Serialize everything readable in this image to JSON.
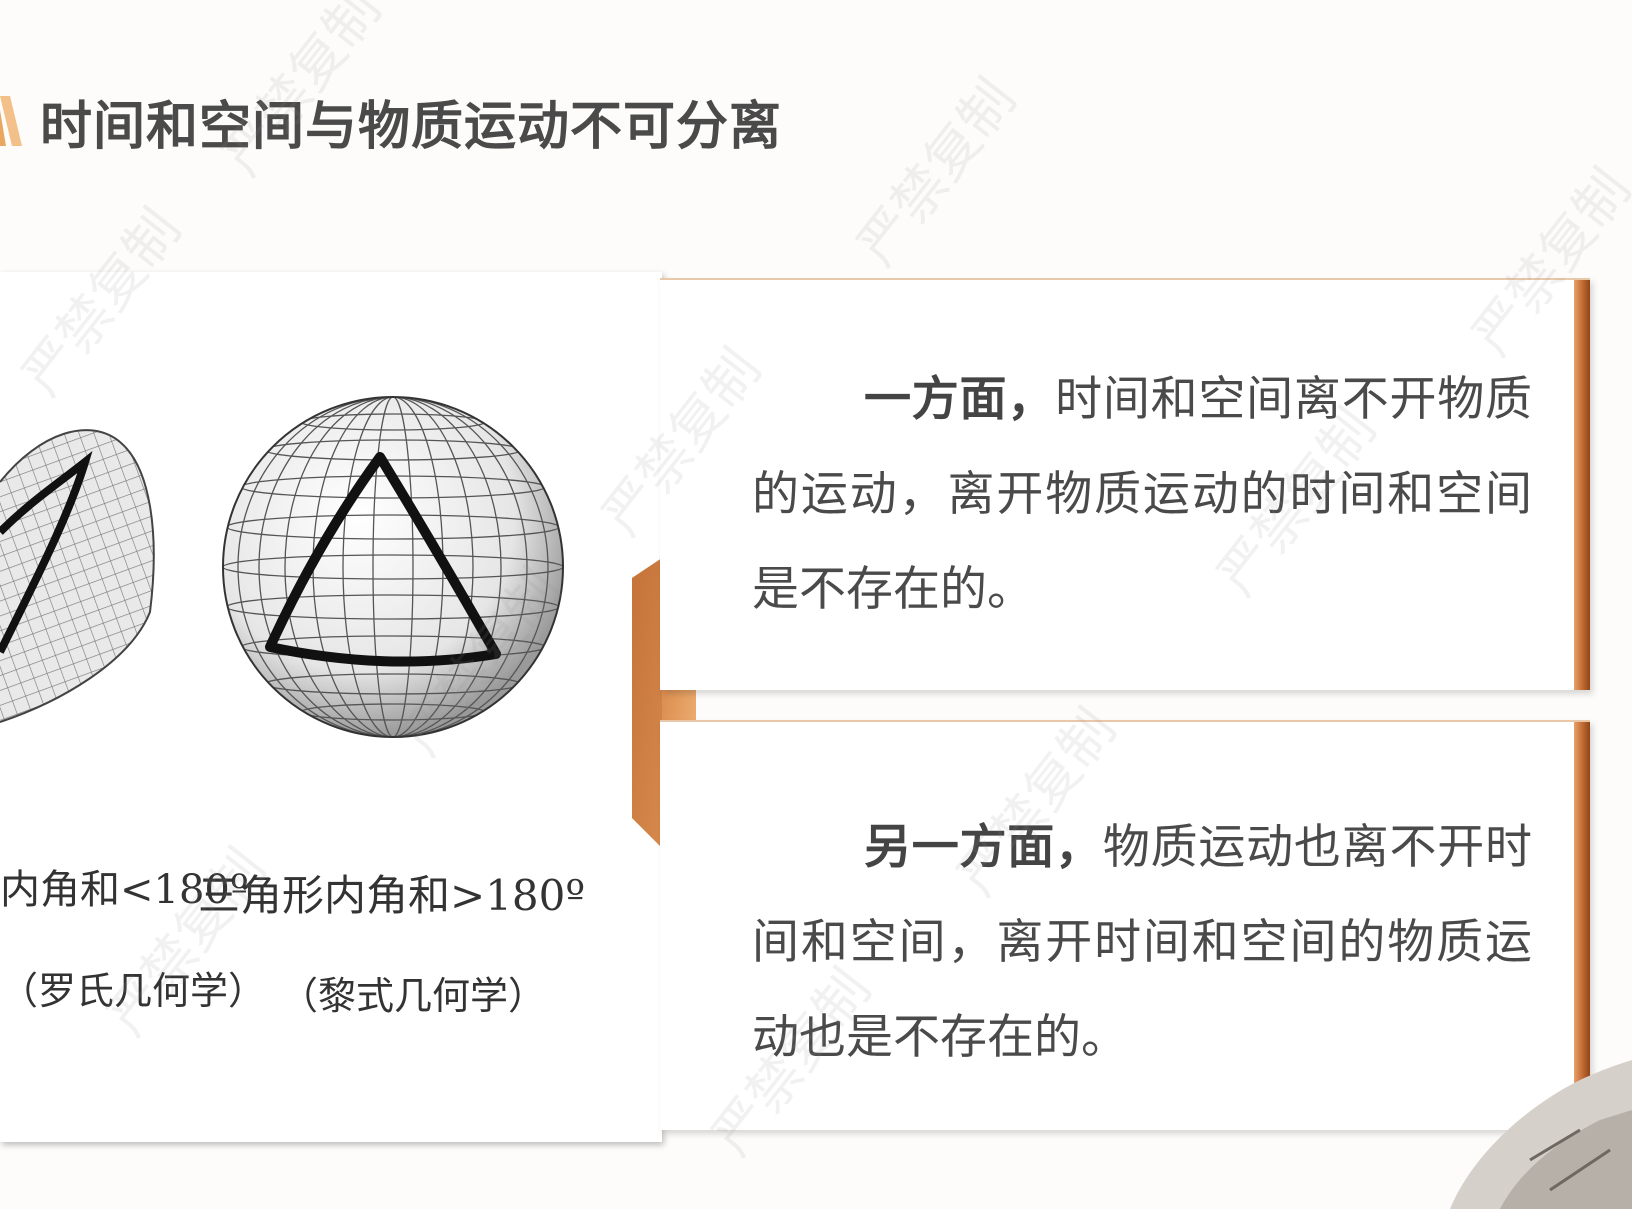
{
  "title": "时间和空间与物质运动不可分离",
  "figures": {
    "left": {
      "caption": "内角和<180º",
      "subcaption": "（罗氏几何学）"
    },
    "right": {
      "caption": "三角形内角和>180º",
      "subcaption": "（黎式几何学）"
    }
  },
  "cards": [
    {
      "lead": "一方面，",
      "body": "时间和空间离不开物质的运动，离开物质运动的时间和空间是不存在的。"
    },
    {
      "lead": "另一方面，",
      "body": "物质运动也离不开时间和空间，离开时间和空间的物质运动也是不存在的。"
    }
  ],
  "watermark": "严禁复制",
  "colors": {
    "accent": "#c06a32",
    "accent_light": "#e8a067",
    "title_deco": "#f0b46d",
    "text": "#4a4a4a"
  }
}
